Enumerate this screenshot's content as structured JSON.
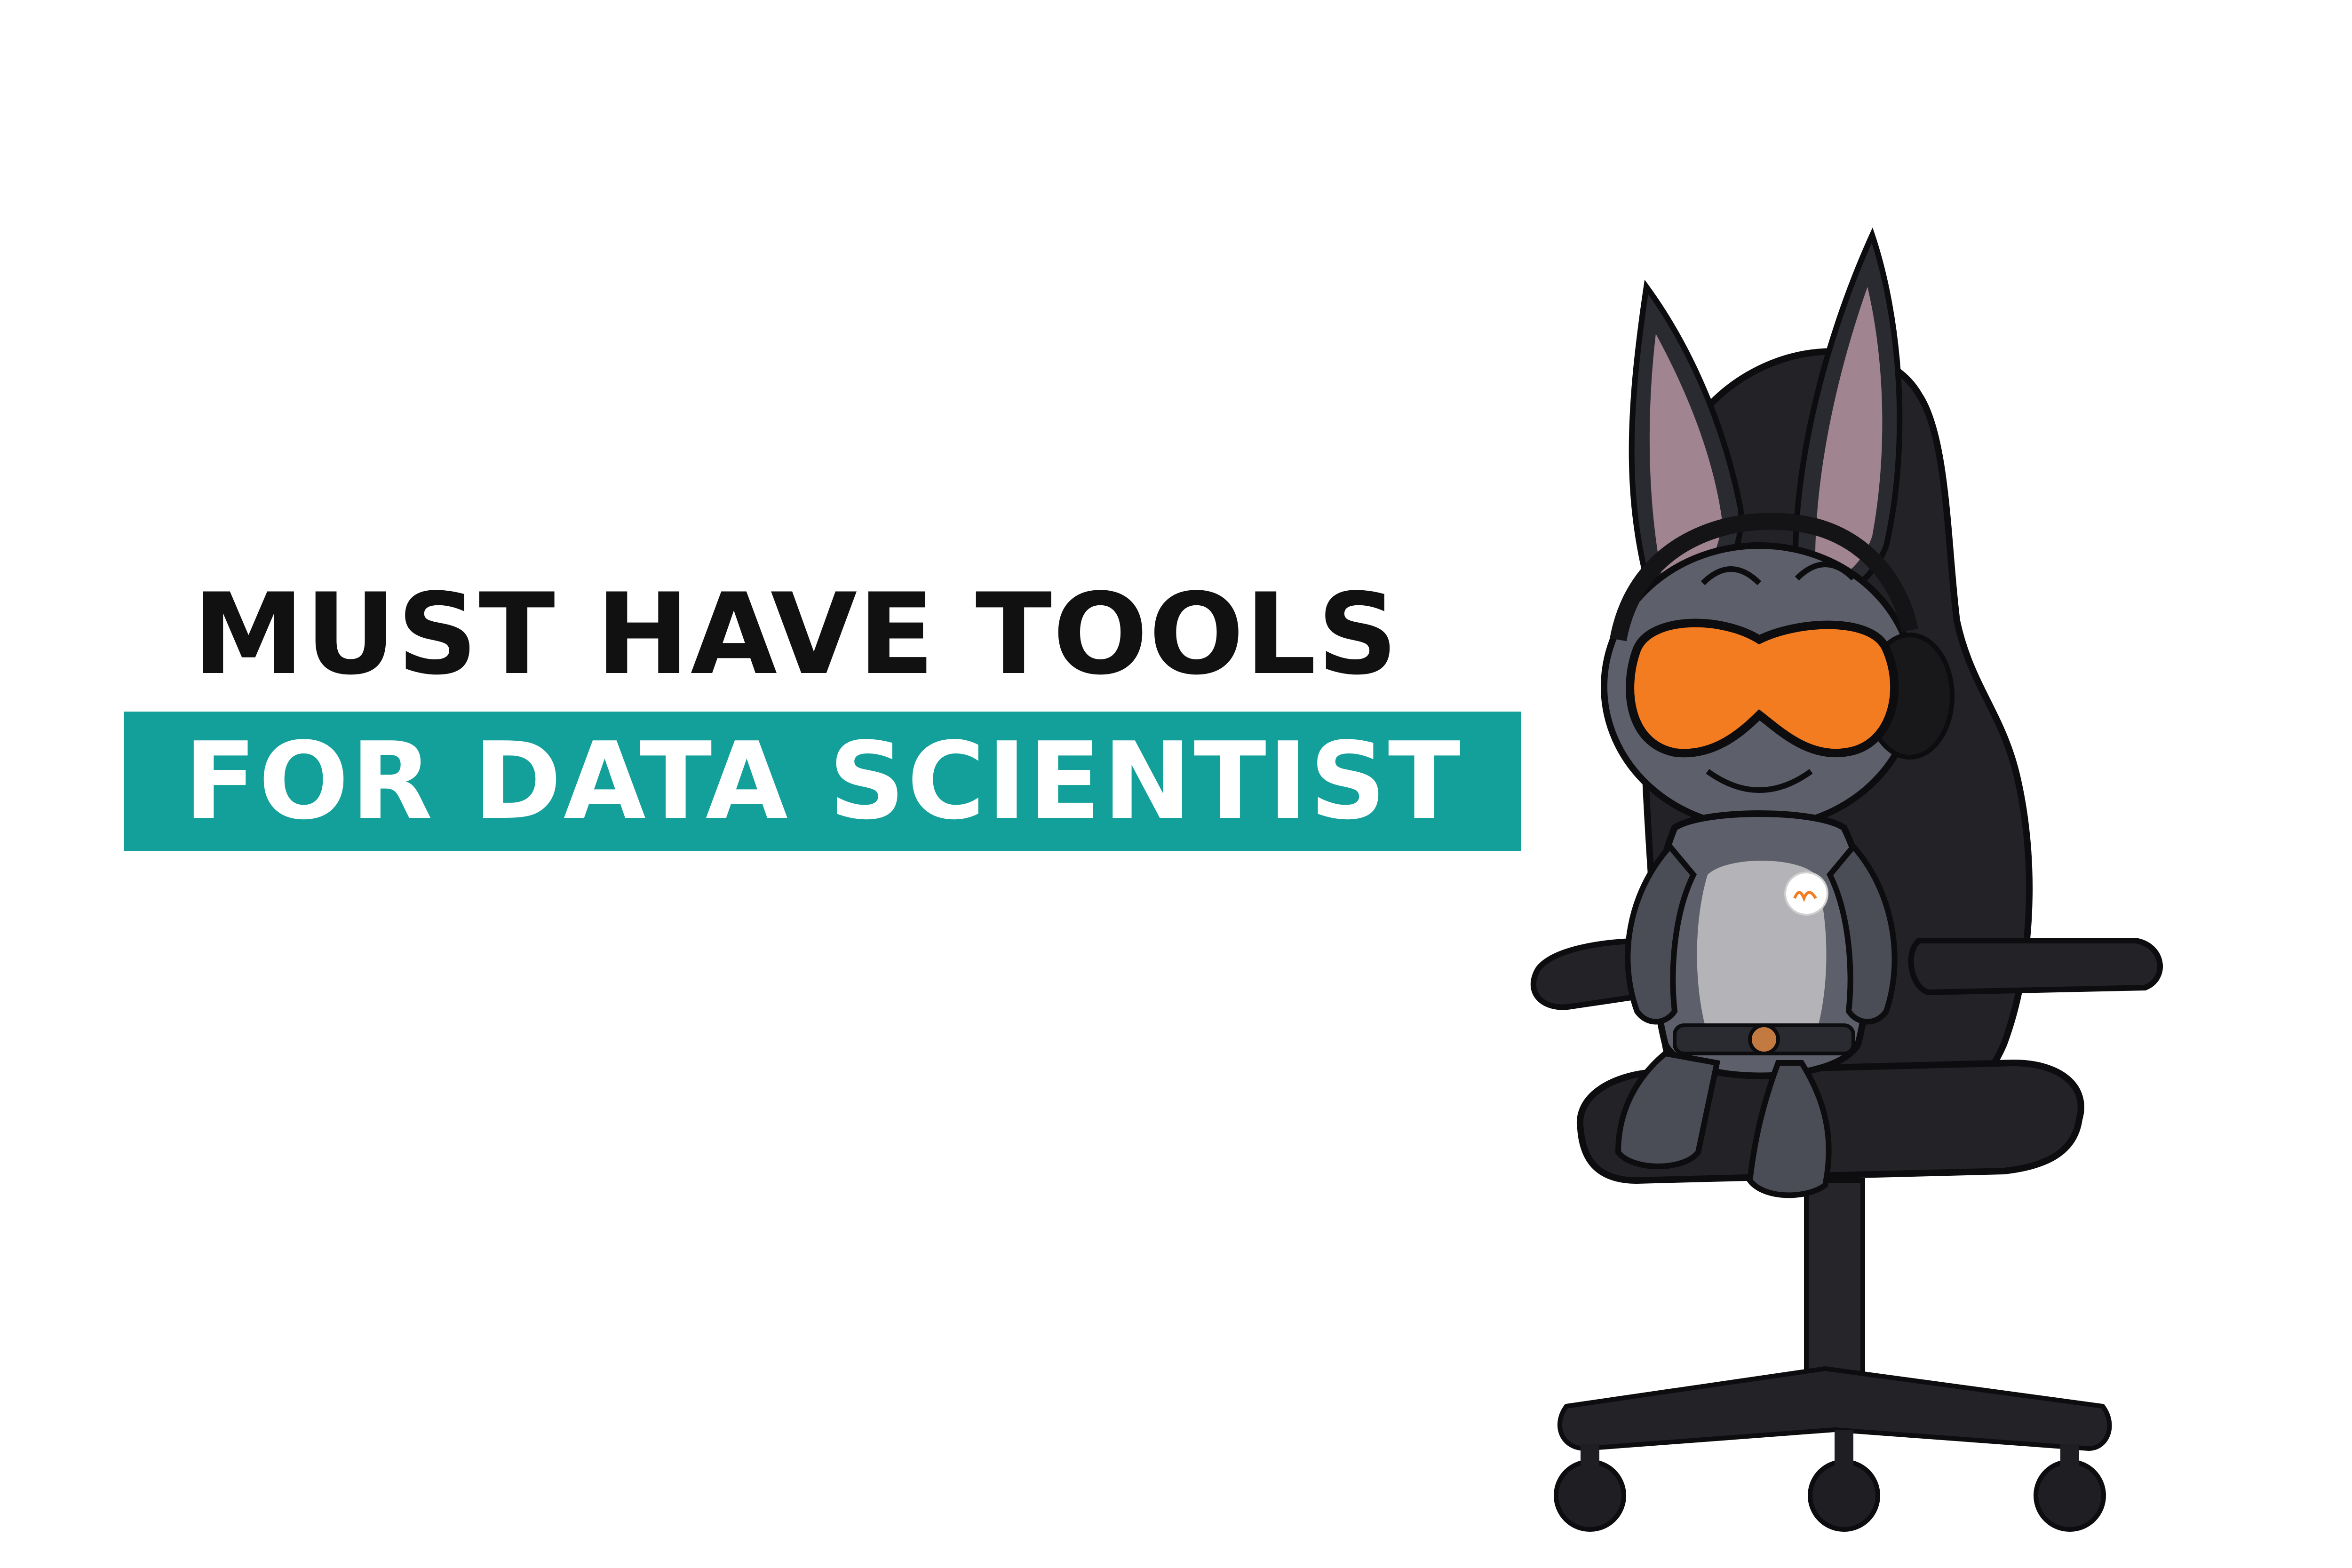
{
  "headline": {
    "line1": "MUST HAVE TOOLS",
    "line2": "FOR DATA SCIENTIST"
  },
  "colors": {
    "background": "#ffffff",
    "headline_text": "#111111",
    "band": "#14a09a",
    "band_text": "#ffffff",
    "goggles": "#f47c20",
    "chair": "#232327",
    "character_body": "#5d5f6a",
    "ear_inner": "#a08490",
    "belly": "#b4b4b8"
  },
  "illustration": {
    "subject": "cartoon bat-eared creature wearing orange goggles and headphones sitting in a black gaming chair",
    "badge_logo": "wm-logo"
  }
}
